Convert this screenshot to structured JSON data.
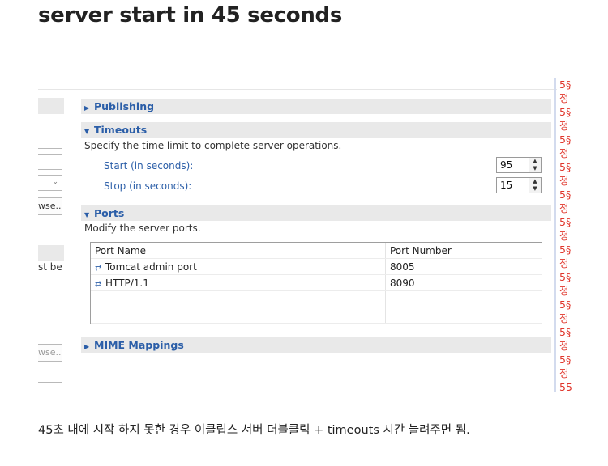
{
  "heading": "server start in 45 seconds",
  "left_panel": {
    "browse_button_1": "wse...",
    "partial_text": "st be",
    "browse_button_2": "wse..."
  },
  "sections": {
    "publishing": "Publishing",
    "timeouts": "Timeouts",
    "timeouts_desc": "Specify the time limit to complete server operations.",
    "start_label": "Start (in seconds):",
    "start_value": "95",
    "stop_label": "Stop (in seconds):",
    "stop_value": "15",
    "ports": "Ports",
    "ports_desc": "Modify the server ports.",
    "mime": "MIME Mappings"
  },
  "ports_table": {
    "headers": [
      "Port Name",
      "Port Number"
    ],
    "rows": [
      {
        "name": "Tomcat admin port",
        "number": "8005"
      },
      {
        "name": "HTTP/1.1",
        "number": "8090"
      }
    ]
  },
  "margin_text": [
    "5§",
    "정",
    "5§",
    "정",
    "5§",
    "정",
    "5§",
    "정",
    "5§",
    "정",
    "5§",
    "정",
    "5§",
    "정",
    "5§",
    "정",
    "5§",
    "정",
    "5§",
    "정",
    "5§",
    "정",
    "55"
  ],
  "footer": "45초 내에 시작 하지 못한 경우 이클립스 서버 더블클릭 + timeouts 시간 늘려주면 됨.",
  "colors": {
    "link_blue": "#2b5ea8",
    "margin_red": "#e0352b",
    "section_bg": "#e9e9e9"
  },
  "icons": {
    "port": "port-icon",
    "collapsed": "triangle-right-icon",
    "expanded": "triangle-down-icon"
  }
}
